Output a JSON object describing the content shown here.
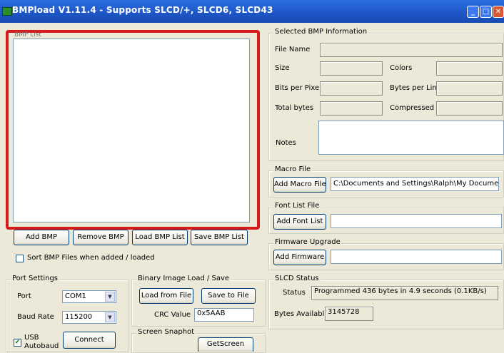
{
  "window": {
    "title": "BMPload V1.11.4 - Supports SLCD/+, SLCD6, SLCD43",
    "buttons": [
      "minimize",
      "maximize",
      "close"
    ]
  },
  "bmp_list": {
    "label": "BMP List",
    "items": [],
    "highlight_color": "#d41a1a"
  },
  "bmp_buttons": {
    "add": "Add BMP",
    "remove": "Remove BMP",
    "load": "Load BMP List",
    "save": "Save BMP List"
  },
  "sort_checkbox": {
    "label": "Sort BMP Files when added / loaded",
    "checked": false
  },
  "selected_info": {
    "label": "Selected BMP Information",
    "file_name_label": "File Name",
    "size_label": "Size",
    "colors_label": "Colors",
    "bpp_label": "Bits per Pixel",
    "bytes_per_line_label": "Bytes per Line",
    "total_bytes_label": "Total bytes",
    "compressed_label": "Compressed",
    "notes_label": "Notes"
  },
  "macro_file": {
    "label": "Macro File",
    "button": "Add Macro File",
    "value": "C:\\Documents and Settings\\Ralph\\My Documents\\C"
  },
  "font_list": {
    "label": "Font List File",
    "button": "Add Font List",
    "value": ""
  },
  "firmware": {
    "label": "Firmware Upgrade",
    "button": "Add Firmware",
    "value": ""
  },
  "port_settings": {
    "label": "Port Settings",
    "port_label": "Port",
    "port_value": "COM1",
    "baud_label": "Baud Rate",
    "baud_value": "115200",
    "usb_label_1": "USB",
    "usb_label_2": "Autobaud",
    "usb_checked": true,
    "connect": "Connect"
  },
  "binary_image": {
    "label": "Binary Image Load / Save",
    "load": "Load from File",
    "save": "Save to File",
    "crc_label": "CRC Value",
    "crc_value": "0x5AAB"
  },
  "screen_snapshot": {
    "label": "Screen Snaphot",
    "button": "GetScreen"
  },
  "slcd_status": {
    "label": "SLCD Status",
    "status_label": "Status",
    "status_value": "Programmed 436 bytes in 4.9 seconds (0.1KB/s)",
    "bytes_label": "Bytes Available",
    "bytes_value": "3145728"
  }
}
